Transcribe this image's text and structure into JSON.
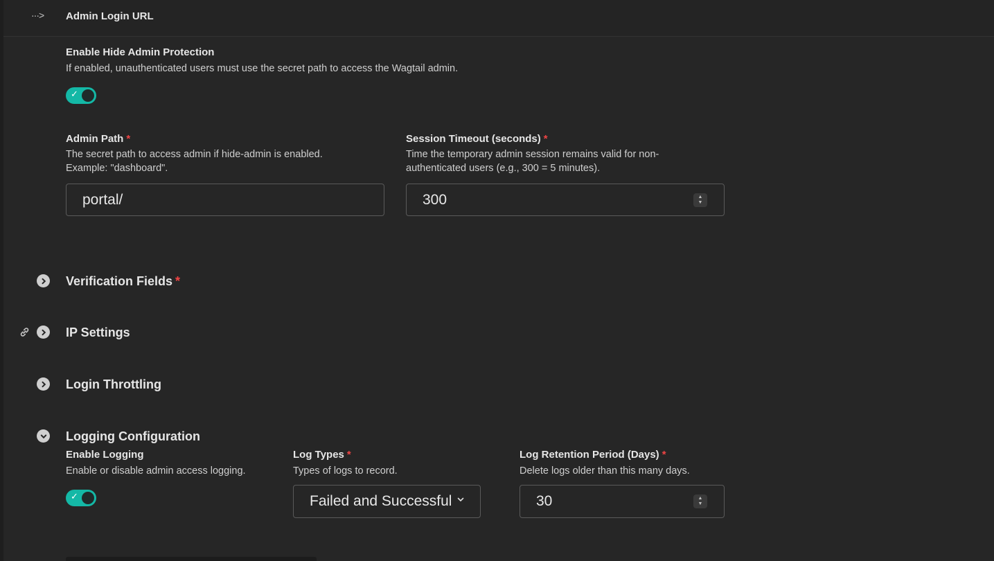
{
  "header": {
    "arrow_icon": "ellipsis-arrow-icon",
    "title": "Admin Login URL"
  },
  "hide_admin": {
    "label": "Enable Hide Admin Protection",
    "help": "If enabled, unauthenticated users must use the secret path to access the Wagtail admin.",
    "enabled": true
  },
  "admin_path": {
    "label": "Admin Path",
    "required_mark": "*",
    "help_line1": "The secret path to access admin if hide-admin is enabled.",
    "help_line2": "Example: \"dashboard\".",
    "value": "portal/"
  },
  "session_timeout": {
    "label": "Session Timeout (seconds)",
    "required_mark": "*",
    "help_line1": "Time the temporary admin session remains valid for non-",
    "help_line2": "authenticated users (e.g., 300 = 5 minutes).",
    "value": "300"
  },
  "panels": [
    {
      "title": "Verification Fields",
      "required_mark": "*",
      "expanded": false
    },
    {
      "title": "IP Settings",
      "expanded": false,
      "link_icon": "link-icon"
    },
    {
      "title": "Login Throttling",
      "expanded": false
    },
    {
      "title": "Logging Configuration",
      "expanded": true
    }
  ],
  "logging": {
    "enable": {
      "label": "Enable Logging",
      "help": "Enable or disable admin access logging.",
      "enabled": true
    },
    "log_types": {
      "label": "Log Types",
      "required_mark": "*",
      "help": "Types of logs to record.",
      "value": "Failed and Successful"
    },
    "retention": {
      "label": "Log Retention Period (Days)",
      "required_mark": "*",
      "help": "Delete logs older than this many days.",
      "value": "30"
    }
  },
  "colors": {
    "accent": "#14b8a6",
    "required": "#ef4444",
    "background": "#262626"
  }
}
